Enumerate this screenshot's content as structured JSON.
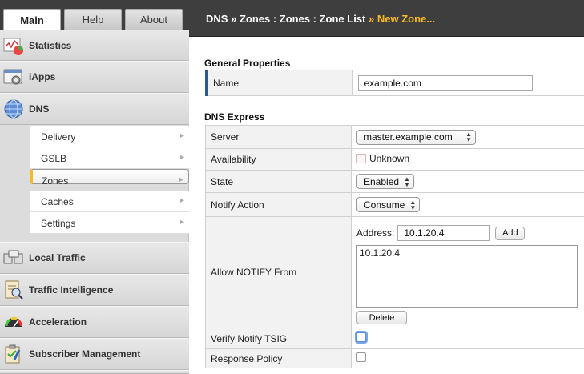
{
  "tabs": [
    "Main",
    "Help",
    "About"
  ],
  "sidebar": {
    "sections": [
      {
        "label": "Statistics",
        "icon": "statistics-icon"
      },
      {
        "label": "iApps",
        "icon": "iapps-icon"
      },
      {
        "label": "DNS",
        "icon": "dns-globe-icon"
      },
      {
        "label": "Local Traffic",
        "icon": "local-traffic-icon"
      },
      {
        "label": "Traffic Intelligence",
        "icon": "traffic-intelligence-icon"
      },
      {
        "label": "Acceleration",
        "icon": "acceleration-gauge-icon"
      },
      {
        "label": "Subscriber Management",
        "icon": "subscriber-management-icon"
      }
    ],
    "dns_items": [
      "Delivery",
      "GSLB",
      "Zones",
      "Caches",
      "Settings"
    ],
    "selected_item": "Zones"
  },
  "breadcrumb": {
    "parts": [
      "DNS",
      "Zones : Zones : Zone List"
    ],
    "separator": "»",
    "current": "New Zone..."
  },
  "general": {
    "heading": "General Properties",
    "name_label": "Name",
    "name_value": "example.com"
  },
  "express": {
    "heading": "DNS Express",
    "server_label": "Server",
    "server_value": "master.example.com",
    "availability_label": "Availability",
    "availability_value": "Unknown",
    "state_label": "State",
    "state_value": "Enabled",
    "notify_action_label": "Notify Action",
    "notify_action_value": "Consume",
    "allow_notify_label": "Allow NOTIFY From",
    "address_label": "Address:",
    "address_value": "10.1.20.4",
    "add_button": "Add",
    "list_items": [
      "10.1.20.4"
    ],
    "delete_button": "Delete",
    "verify_tsig_label": "Verify Notify TSIG",
    "response_policy_label": "Response Policy"
  },
  "colors": {
    "accent": "#f7b924",
    "topbar": "#3e3e3e",
    "sidebar": "#dcdcdc"
  }
}
